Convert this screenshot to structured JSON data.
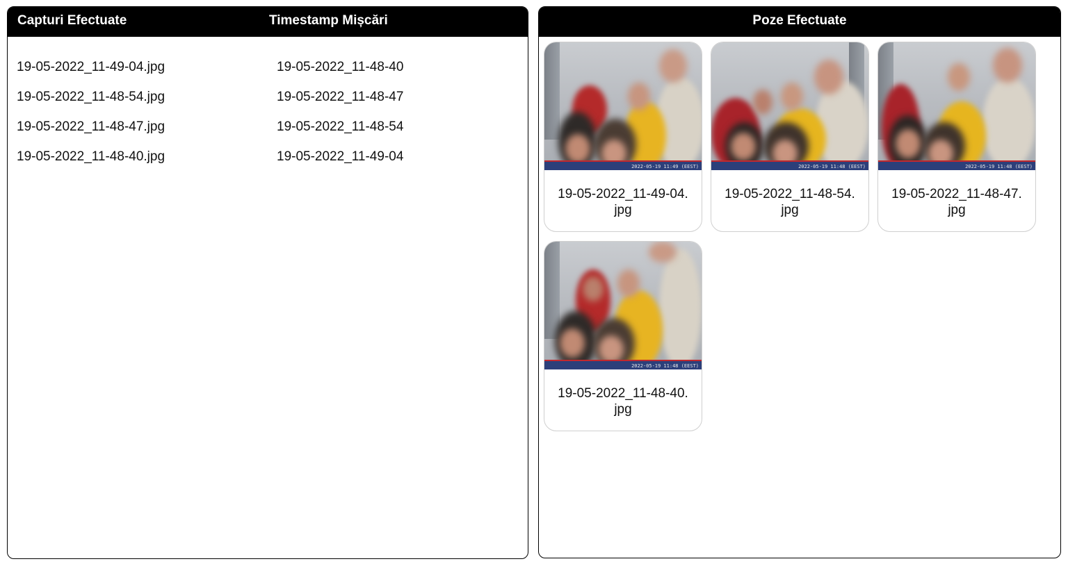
{
  "left_panel": {
    "header_col1": "Capturi Efectuate",
    "header_col2": "Timestamp Mișcări",
    "rows": [
      {
        "capture": "19-05-2022_11-49-04.jpg",
        "timestamp": "19-05-2022_11-48-40"
      },
      {
        "capture": "19-05-2022_11-48-54.jpg",
        "timestamp": "19-05-2022_11-48-47"
      },
      {
        "capture": "19-05-2022_11-48-47.jpg",
        "timestamp": "19-05-2022_11-48-54"
      },
      {
        "capture": "19-05-2022_11-48-40.jpg",
        "timestamp": "19-05-2022_11-49-04"
      }
    ]
  },
  "right_panel": {
    "header": "Poze Efectuate",
    "photos": [
      {
        "filename": "19-05-2022_11-49-04.jpg",
        "overlay": "2022-05-19 11:49 (EEST)"
      },
      {
        "filename": "19-05-2022_11-48-54.jpg",
        "overlay": "2022-05-19 11:48 (EEST)"
      },
      {
        "filename": "19-05-2022_11-48-47.jpg",
        "overlay": "2022-05-19 11:48 (EEST)"
      },
      {
        "filename": "19-05-2022_11-48-40.jpg",
        "overlay": "2022-05-19 11:48 (EEST)"
      }
    ]
  },
  "colors": {
    "header_bg": "#000000",
    "header_text": "#ffffff",
    "photo_bar": "#2c3f7a",
    "photo_bar_line": "#c2282e"
  }
}
